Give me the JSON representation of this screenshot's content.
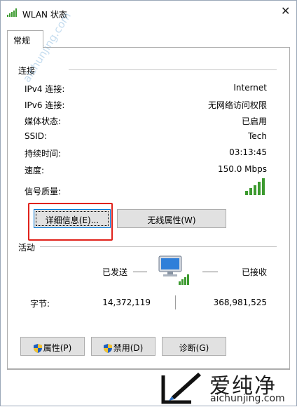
{
  "window": {
    "title": "WLAN 状态",
    "close_glyph": "✕"
  },
  "tab": {
    "label": "常规"
  },
  "connection": {
    "group_title": "连接",
    "rows": [
      {
        "label": "IPv4 连接:",
        "value": "Internet"
      },
      {
        "label": "IPv6 连接:",
        "value": "无网络访问权限"
      },
      {
        "label": "媒体状态:",
        "value": "已启用"
      },
      {
        "label": "SSID:",
        "value": "Tech"
      },
      {
        "label": "持续时间:",
        "value": "03:13:45"
      },
      {
        "label": "速度:",
        "value": "150.0 Mbps"
      }
    ],
    "signal_label": "信号质量:",
    "signal_bars_lit": 5,
    "signal_bars_total": 5
  },
  "buttons": {
    "details": "详细信息(E)...",
    "wireless_props": "无线属性(W)",
    "properties": "属性(P)",
    "disable": "禁用(D)",
    "diagnose": "诊断(G)"
  },
  "activity": {
    "group_title": "活动",
    "sent_label": "已发送",
    "received_label": "已接收",
    "bytes_label": "字节:",
    "bytes_sent": "14,372,119",
    "bytes_received": "368,981,525"
  },
  "watermark": {
    "title": "爱纯净",
    "url": "aichunjing.com",
    "diagonal": "aichunjing.com"
  },
  "colors": {
    "highlight": "#e0221b",
    "signal_green": "#3c9a2f",
    "focus_blue": "#0078d7"
  },
  "icons": {
    "wifi": "wifi-signal-icon",
    "network": "network-computer-icon",
    "shield": "uac-shield-icon"
  }
}
